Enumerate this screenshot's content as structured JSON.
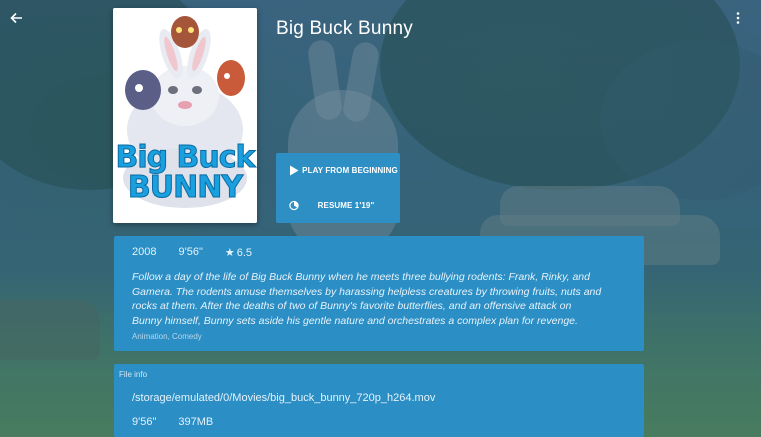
{
  "header": {
    "back_icon": "arrow-back-icon",
    "menu_icon": "more-vert-icon"
  },
  "poster": {
    "title_line1": "Big Buck",
    "title_line2": "BUNNY"
  },
  "title": "Big Buck Bunny",
  "actions": {
    "play_label": "PLAY FROM BEGINNING",
    "play_icon": "play-icon",
    "resume_label": "RESUME 1'19\"",
    "resume_icon": "resume-progress-icon"
  },
  "details": {
    "year": "2008",
    "duration": "9'56\"",
    "rating": "6.5",
    "description": "Follow a day of the life of Big Buck Bunny when he meets three bullying rodents: Frank, Rinky, and Gamera. The rodents amuse themselves by harassing helpless creatures by throwing fruits, nuts and rocks at them. After the deaths of two of Bunny's favorite butterflies, and an offensive attack on Bunny himself, Bunny sets aside his gentle nature and orchestrates a complex plan for revenge.",
    "genres": "Animation, Comedy"
  },
  "file_info": {
    "label": "File info",
    "path": "/storage/emulated/0/Movies/big_buck_bunny_720p_h264.mov",
    "duration": "9'56\"",
    "size": "397MB"
  },
  "colors": {
    "card": "#2b8ec4",
    "button": "#2e8fc4",
    "text": "#ffffff"
  }
}
